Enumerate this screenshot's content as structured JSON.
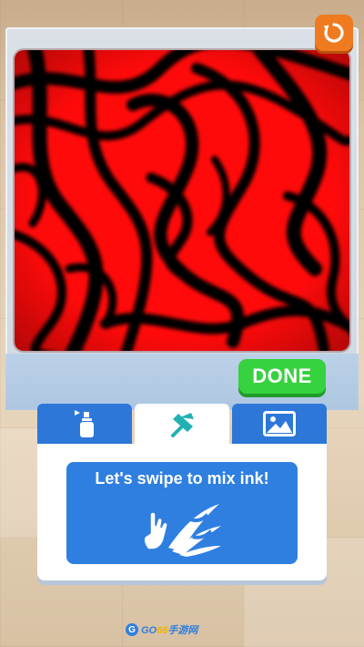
{
  "game": {
    "done_label": "DONE",
    "hint_text": "Let's swipe to mix ink!",
    "ink_colors": {
      "primary": "#ff0a0a",
      "secondary": "#000000"
    },
    "accent_colors": {
      "done": "#36d23f",
      "tab": "#2d77d9",
      "restart": "#f07a1f"
    }
  },
  "toolbar": {
    "tabs": [
      {
        "icon": "spray-can-icon",
        "active": false
      },
      {
        "icon": "stir-tool-icon",
        "active": true
      },
      {
        "icon": "image-icon",
        "active": false
      }
    ]
  },
  "watermark": {
    "text_a": "GO",
    "text_b": "66",
    "text_c": "手游网"
  }
}
